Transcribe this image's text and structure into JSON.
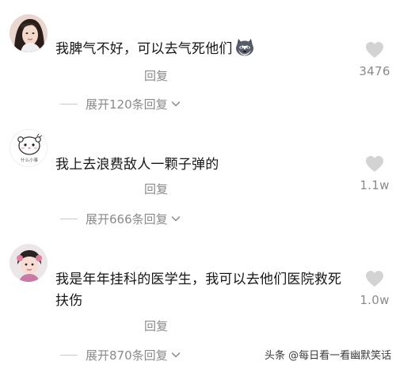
{
  "comments": [
    {
      "text": "我脾气不好，可以去气死他们",
      "emoji": "husky-emoji",
      "reply_label": "回复",
      "expand_label": "展开120条回复",
      "likes": "3476"
    },
    {
      "text": "我上去浪费敌人一颗子弹的",
      "reply_label": "回复",
      "expand_label": "展开666条回复",
      "likes": "1.1w"
    },
    {
      "text": "我是年年挂科的医学生，我可以去他们医院救死扶伤",
      "reply_label": "回复",
      "expand_label": "展开870条回复",
      "likes": "1.0w"
    }
  ],
  "watermark": "头条 @每日看一看幽默笑话",
  "avatar2_caption": "什么小事",
  "colors": {
    "heart": "#d3d3d3",
    "muted_text": "#8a8a8a"
  }
}
